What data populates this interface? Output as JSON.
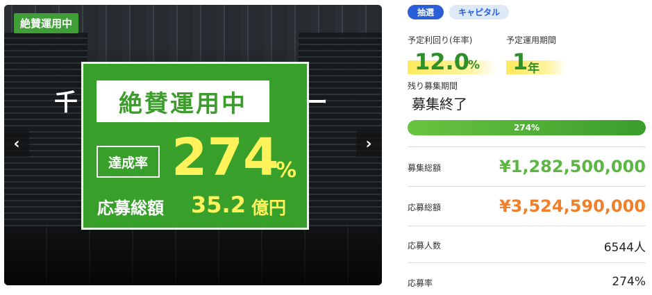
{
  "hero": {
    "corner_badge": "絶賛運用中",
    "bg_title_left": "千",
    "bg_title_right": "ー",
    "promo": {
      "banner": "絶賛運用中",
      "rate_label": "達成率",
      "rate_value": "274",
      "rate_unit": "%",
      "total_label": "応募総額",
      "total_value": "35.2",
      "total_unit": "億円"
    },
    "prev_arrow": "‹",
    "next_arrow": "›"
  },
  "tags": [
    "抽選",
    "キャピタル"
  ],
  "stats": {
    "yield_label": "予定利回り(年率)",
    "yield_value": "12.0",
    "yield_unit": "%",
    "period_label": "予定運用期間",
    "period_value": "1",
    "period_unit": "年",
    "remaining_label": "残り募集期間",
    "remaining_value": "募集終了"
  },
  "progress": {
    "label": "274%",
    "fraction": 1.0
  },
  "details": [
    {
      "key": "募集総額",
      "value": "¥1,282,500,000",
      "style": "green"
    },
    {
      "key": "応募総額",
      "value": "¥3,524,590,000",
      "style": "orange"
    },
    {
      "key": "応募人数",
      "value": "6544人",
      "style": "plain"
    },
    {
      "key": "応募率",
      "value": "274%",
      "style": "plain"
    }
  ],
  "colors": {
    "brand_green": "#3f9e35",
    "accent_yellow": "#fff25a",
    "tag_blue": "#2a5fd9",
    "amount_orange": "#ef7f2a"
  }
}
